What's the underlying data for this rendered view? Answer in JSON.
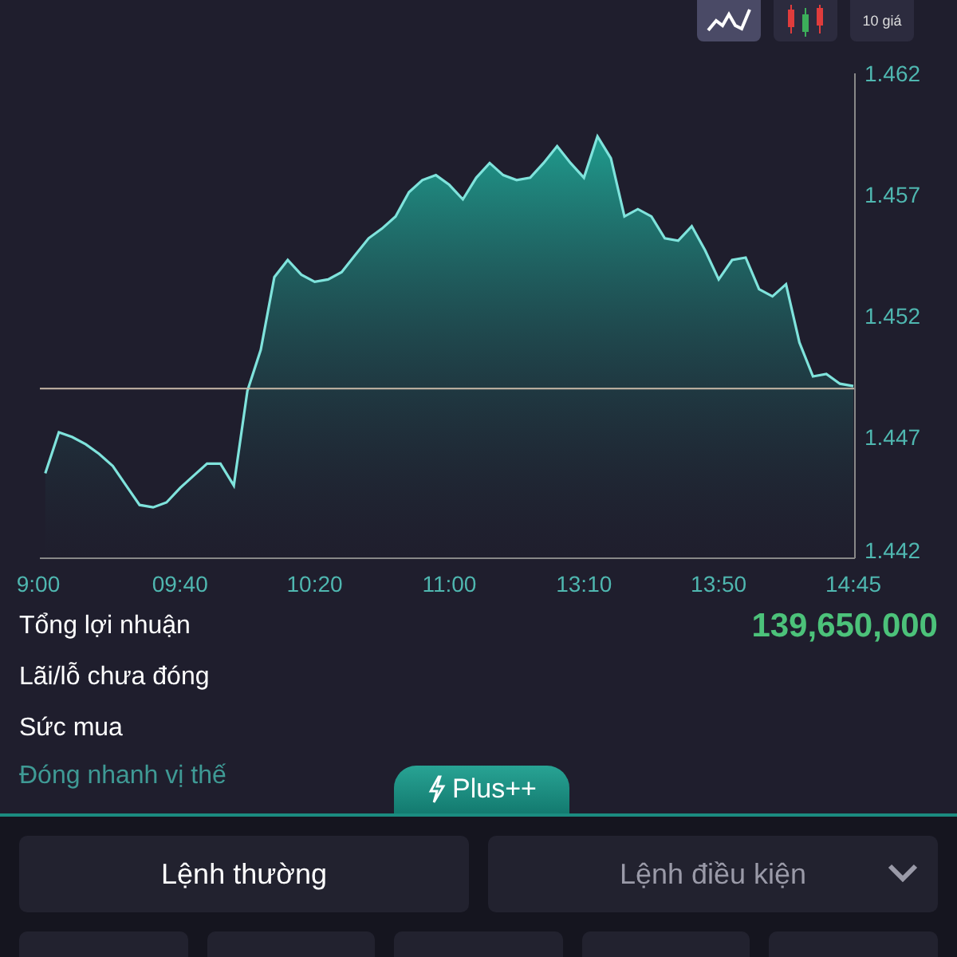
{
  "toolbar": [
    {
      "kind": "line",
      "selected": true
    },
    {
      "kind": "candle",
      "selected": false
    },
    {
      "kind": "text",
      "label": "10 giá",
      "selected": false
    }
  ],
  "chart_data": {
    "type": "area",
    "ylim": [
      1.442,
      1.462
    ],
    "yticks": [
      1.442,
      1.447,
      1.452,
      1.457,
      1.462
    ],
    "categories": [
      "9:00",
      null,
      null,
      null,
      null,
      null,
      null,
      null,
      null,
      null,
      null,
      "09:40",
      null,
      null,
      null,
      null,
      null,
      null,
      null,
      null,
      null,
      "10:20",
      null,
      null,
      null,
      null,
      null,
      null,
      null,
      null,
      null,
      "11:00",
      null,
      null,
      null,
      null,
      null,
      null,
      null,
      null,
      null,
      "13:10",
      null,
      null,
      null,
      null,
      null,
      null,
      null,
      null,
      null,
      "13:50",
      null,
      null,
      null,
      null,
      null,
      null,
      null,
      null,
      null,
      "14:45"
    ],
    "series": [
      {
        "color": "#7fe3dc",
        "values": [
          null,
          1.4455,
          1.4472,
          1.447,
          1.4467,
          1.4463,
          1.4458,
          1.445,
          1.4442,
          1.4441,
          1.4443,
          1.4449,
          1.4454,
          1.4459,
          1.4459,
          1.445,
          1.4489,
          1.4506,
          1.4536,
          1.4543,
          1.4537,
          1.4534,
          1.4535,
          1.4538,
          1.4545,
          1.4552,
          1.4556,
          1.4561,
          1.4571,
          1.4576,
          1.4578,
          1.4574,
          1.4568,
          1.4577,
          1.4583,
          1.4578,
          1.4576,
          1.4577,
          1.4583,
          1.459,
          1.4583,
          1.4577,
          1.4594,
          1.4585,
          1.4561,
          1.4564,
          1.4561,
          1.4552,
          1.4551,
          1.4557,
          1.4547,
          1.4535,
          1.4543,
          1.4544,
          1.4531,
          1.4528,
          1.4533,
          1.4509,
          1.4495,
          1.4496,
          1.4492,
          1.4491
        ]
      }
    ],
    "ref_lines": [
      {
        "axis": "y",
        "value": 1.449
      }
    ]
  },
  "stats": [
    {
      "label": "Tổng lợi nhuận",
      "value": "139,650,000"
    },
    {
      "label": "Lãi/lỗ chưa đóng"
    },
    {
      "label": "Sức mua"
    }
  ],
  "quick_close_link": "Đóng nhanh vị thế",
  "plus_tab": "Plus++",
  "order_tabs": [
    {
      "label": "Lệnh thường",
      "selected": true,
      "kind": "plain"
    },
    {
      "label": "Lệnh điều kiện",
      "selected": false,
      "kind": "dropdown"
    }
  ]
}
